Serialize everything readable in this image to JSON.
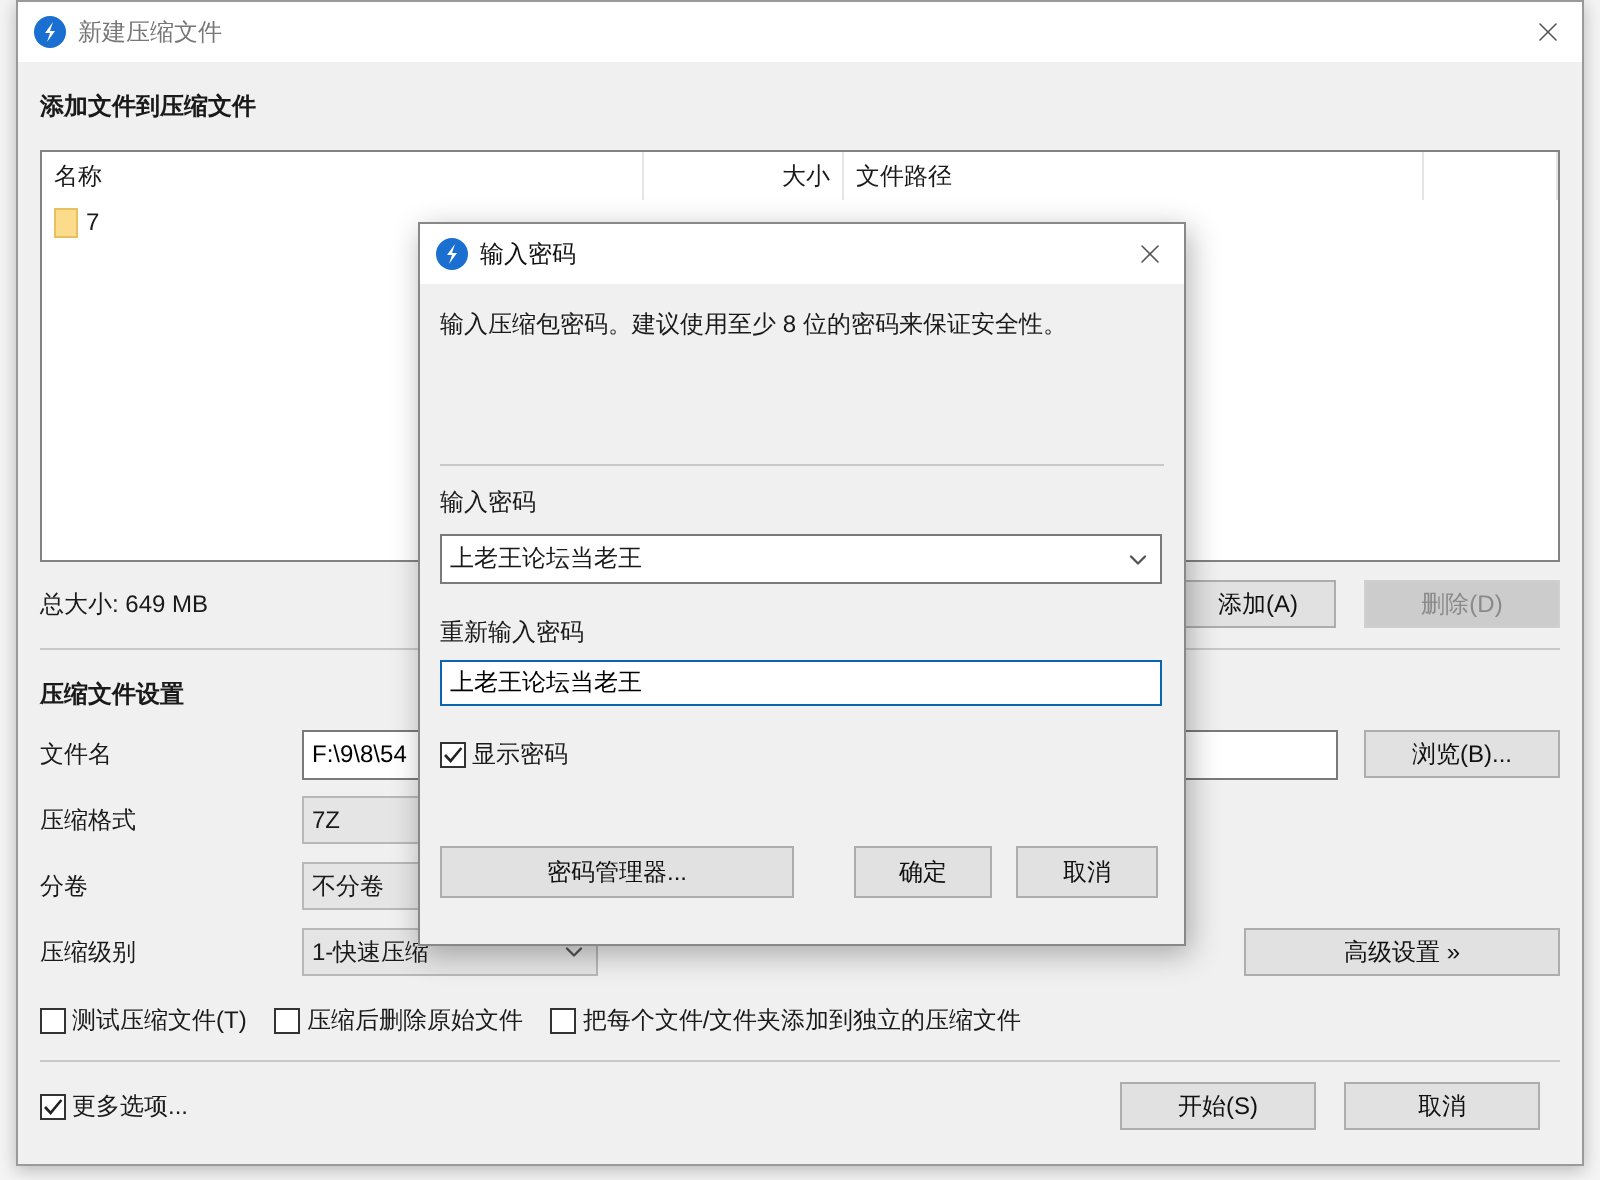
{
  "window": {
    "title": "新建压缩文件"
  },
  "files_section": {
    "heading": "添加文件到压缩文件",
    "columns": [
      "名称",
      "大小",
      "文件路径"
    ],
    "rows": [
      {
        "name": "7"
      }
    ],
    "total": "总大小: 649 MB",
    "buttons": [
      {
        "label": "添加(A)",
        "disabled": false
      },
      {
        "label": "删除(D)",
        "disabled": true
      }
    ]
  },
  "settings": {
    "heading": "压缩文件设置",
    "fields": [
      {
        "kind": "text",
        "label": "文件名",
        "value": "F:\\9\\8\\54",
        "button": "浏览(B)..."
      },
      {
        "kind": "select",
        "label": "压缩格式",
        "value": "7Z"
      },
      {
        "kind": "select",
        "label": "分卷",
        "value": "不分卷"
      },
      {
        "kind": "select",
        "label": "压缩级别",
        "value": "1-快速压缩",
        "button": "高级设置 »"
      }
    ],
    "options": [
      {
        "label": "测试压缩文件(T)",
        "checked": false
      },
      {
        "label": "压缩后删除原始文件",
        "checked": false
      },
      {
        "label": "把每个文件/文件夹添加到独立的压缩文件",
        "checked": false
      }
    ]
  },
  "footer": {
    "more_options": {
      "label": "更多选项...",
      "checked": true
    },
    "buttons": [
      "开始(S)",
      "取消"
    ]
  },
  "password_dialog": {
    "title": "输入密码",
    "hint": "输入压缩包密码。建议使用至少 8 位的密码来保证安全性。",
    "password_label": "输入密码",
    "password": "上老王论坛当老王",
    "confirm_label": "重新输入密码",
    "confirm": "上老王论坛当老王",
    "show_password": {
      "label": "显示密码",
      "checked": true
    },
    "buttons": [
      "密码管理器...",
      "确定",
      "取消"
    ]
  }
}
